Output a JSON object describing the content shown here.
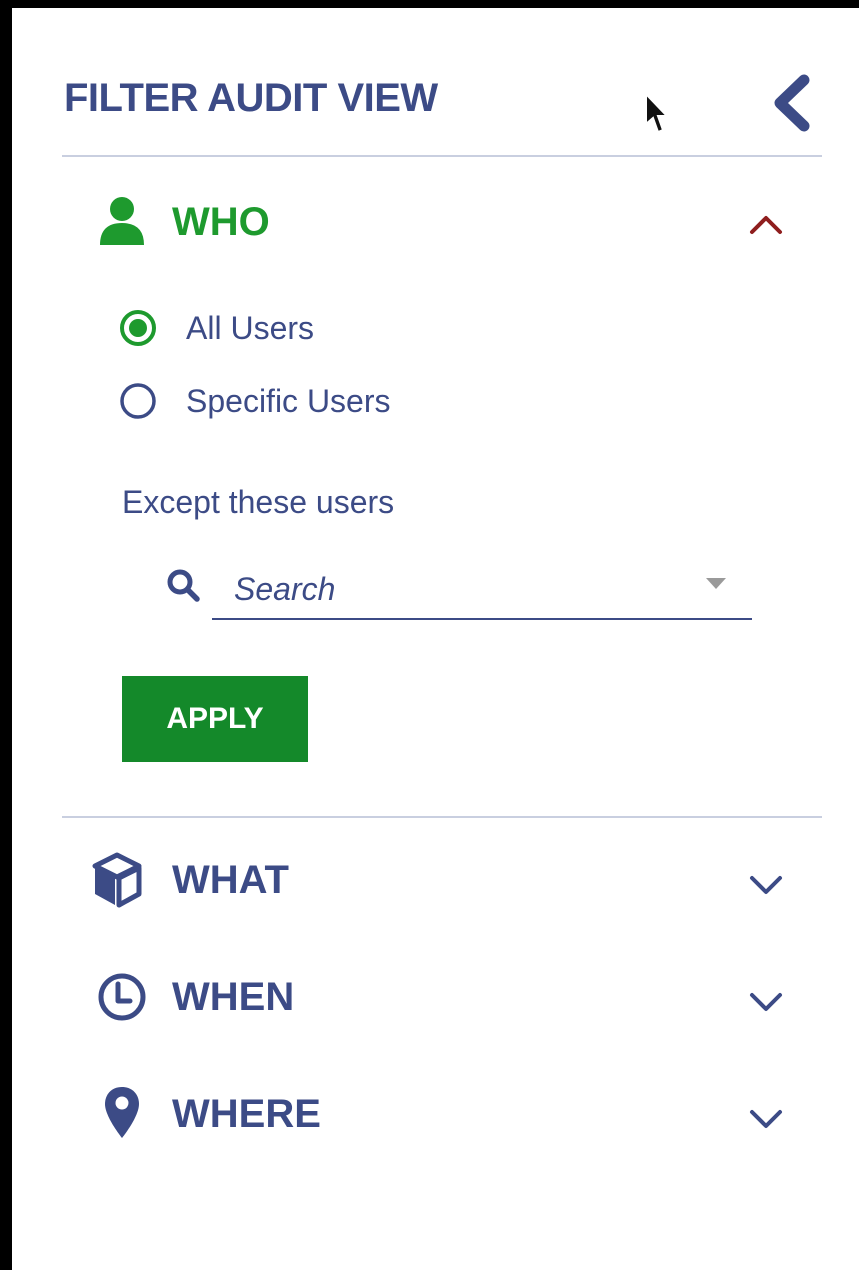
{
  "colors": {
    "navy": "#3c4b86",
    "green": "#1e9a2e",
    "apply_bg": "#14892a",
    "dark_red": "#8f1e1e",
    "divider": "#c9cfe0"
  },
  "header": {
    "title": "FILTER AUDIT VIEW",
    "collapse_icon": "chevron-left-icon"
  },
  "who": {
    "title": "WHO",
    "icon": "user-icon",
    "expanded": true,
    "options": [
      {
        "label": "All Users",
        "selected": true
      },
      {
        "label": "Specific Users",
        "selected": false
      }
    ],
    "except_label": "Except these users",
    "search": {
      "placeholder": "Search",
      "value": ""
    },
    "apply_label": "APPLY"
  },
  "sections": [
    {
      "title": "WHAT",
      "icon": "cube-icon",
      "expanded": false
    },
    {
      "title": "WHEN",
      "icon": "clock-icon",
      "expanded": false
    },
    {
      "title": "WHERE",
      "icon": "map-pin-icon",
      "expanded": false
    }
  ]
}
